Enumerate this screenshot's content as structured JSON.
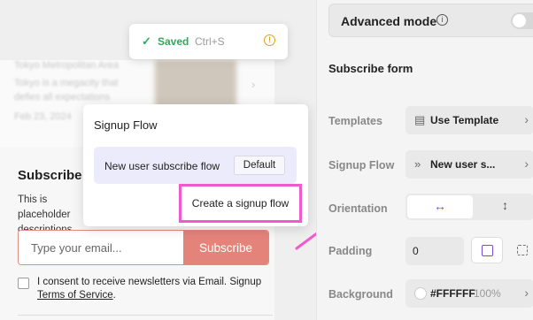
{
  "preview": {
    "blurred_card": {
      "line1": "Tokyo Metropolitan Area",
      "line2": "Tokyo is a megacity that",
      "line3": "defies all expectations",
      "line4": "Feb 23, 2024"
    },
    "subscribe": {
      "title": "Subscribe",
      "description": "This is placeholder descriptions.",
      "email_placeholder": "Type your email...",
      "button_label": "Subscribe",
      "consent_text": "I consent to receive newsletters via Email. Signup",
      "consent_link": "Terms of Service",
      "consent_end": "."
    }
  },
  "toast": {
    "check_icon": "check-icon",
    "status": "Saved",
    "shortcut": "Ctrl+S",
    "warning_icon": "info-warning-icon"
  },
  "signup_popover": {
    "title": "Signup Flow",
    "items": [
      {
        "label": "New user subscribe flow",
        "badge": "Default"
      }
    ],
    "create_label": "Create a signup flow",
    "highlight_color": "#f05acd"
  },
  "panel": {
    "advanced_mode": {
      "label": "Advanced mode",
      "enabled": false
    },
    "section_title": "Subscribe form",
    "rows": {
      "templates": {
        "label": "Templates",
        "value": "Use Template"
      },
      "signup_flow": {
        "label": "Signup Flow",
        "value": "New user s..."
      },
      "orientation": {
        "label": "Orientation",
        "selected": "horizontal"
      },
      "padding": {
        "label": "Padding",
        "value": "0"
      },
      "background": {
        "label": "Background",
        "value": "#FFFFFF",
        "opacity": "100%"
      }
    }
  },
  "colors": {
    "accent_purple": "#7a4ad8",
    "subscribe_button": "#e4837a",
    "saved_green": "#2eaa5c",
    "annotation_pink": "#f05acd"
  }
}
